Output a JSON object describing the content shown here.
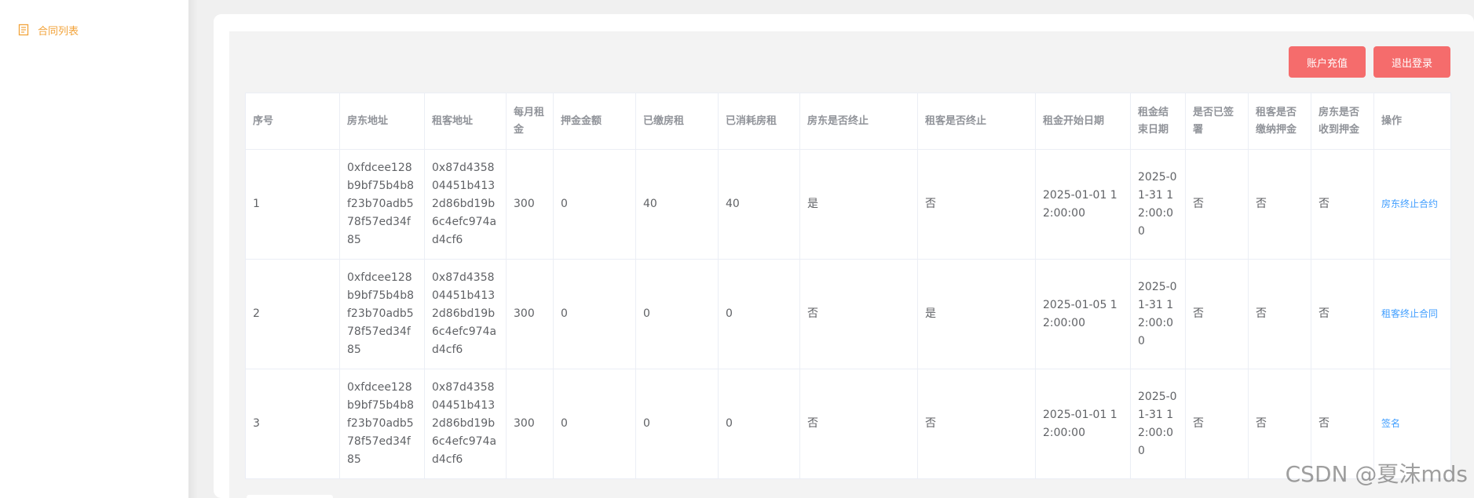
{
  "sidebar": {
    "items": [
      {
        "label": "合同列表",
        "icon": "document-icon"
      }
    ]
  },
  "toolbar": {
    "recharge_label": "账户充值",
    "logout_label": "退出登录"
  },
  "table": {
    "headers": [
      "序号",
      "房东地址",
      "租客地址",
      "每月租金",
      "押金金额",
      "已缴房租",
      "已消耗房租",
      "房东是否终止",
      "租客是否终止",
      "租金开始日期",
      "租金结束日期",
      "是否已签署",
      "租客是否缴纳押金",
      "房东是否收到押金",
      "操作"
    ],
    "rows": [
      [
        "1",
        "0xfdcee128b9bf75b4b8f23b70adb578f57ed34f85",
        "0x87d435804451b4132d86bd19b6c4efc974ad4cf6",
        "300",
        "0",
        "40",
        "40",
        "是",
        "否",
        "2025-01-01 12:00:00",
        "2025-01-31 12:00:00",
        "否",
        "否",
        "否",
        "房东终止合约"
      ],
      [
        "2",
        "0xfdcee128b9bf75b4b8f23b70adb578f57ed34f85",
        "0x87d435804451b4132d86bd19b6c4efc974ad4cf6",
        "300",
        "0",
        "0",
        "0",
        "否",
        "是",
        "2025-01-05 12:00:00",
        "2025-01-31 12:00:00",
        "否",
        "否",
        "否",
        "租客终止合同"
      ],
      [
        "3",
        "0xfdcee128b9bf75b4b8f23b70adb578f57ed34f85",
        "0x87d435804451b4132d86bd19b6c4efc974ad4cf6",
        "300",
        "0",
        "0",
        "0",
        "否",
        "否",
        "2025-01-01 12:00:00",
        "2025-01-31 12:00:00",
        "否",
        "否",
        "否",
        "签名"
      ]
    ]
  },
  "watermark": "CSDN @夏沫mds",
  "colors": {
    "accent": "#f2a33a",
    "danger_button": "#f56c6c",
    "link": "#409eff"
  }
}
